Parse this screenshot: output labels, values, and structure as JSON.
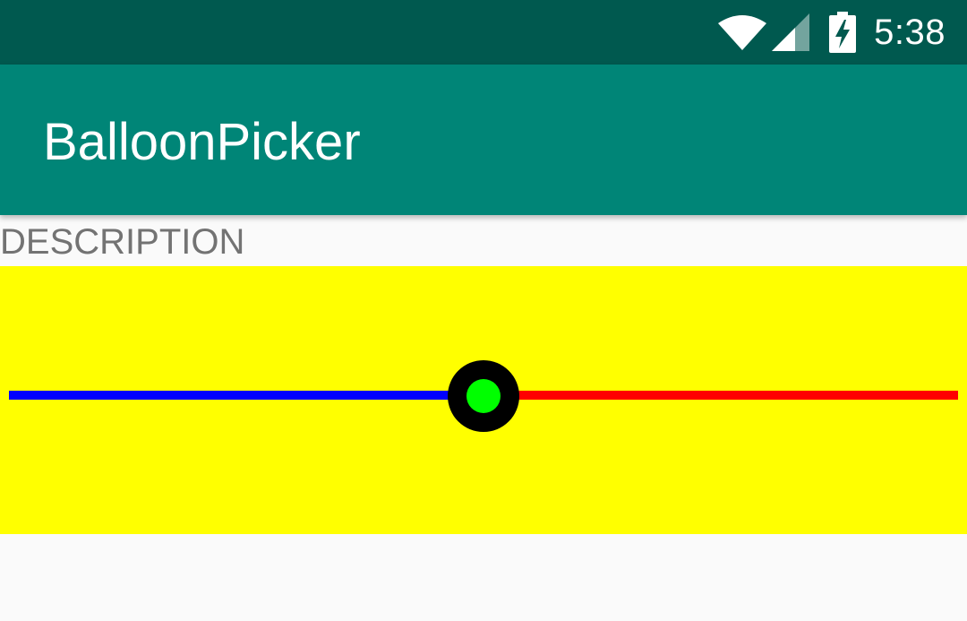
{
  "status_bar": {
    "time": "5:38",
    "icons": [
      "wifi-icon",
      "cell-signal-icon",
      "battery-charging-icon"
    ]
  },
  "app_bar": {
    "title": "BalloonPicker"
  },
  "content": {
    "description": "DESCRIPTION"
  },
  "picker": {
    "value": 0.5,
    "colors": {
      "background": "#ffff00",
      "track_before": "#0000ff",
      "track_after": "#ff0000",
      "thumb_ring": "#000000",
      "thumb_center": "#00ff00"
    }
  },
  "colors": {
    "status_bar": "#00594f",
    "app_bar": "#008577",
    "background": "#fafafa",
    "description_text": "#737373"
  }
}
